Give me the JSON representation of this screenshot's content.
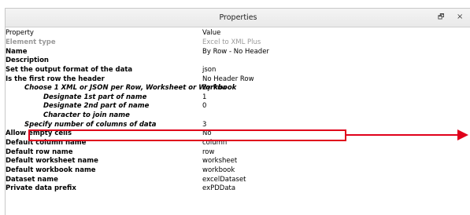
{
  "window": {
    "title": "Properties",
    "restore_glyph": "🗗",
    "close_glyph": "×"
  },
  "columns": {
    "property": "Property",
    "value": "Value"
  },
  "rows": [
    {
      "property": "Element type",
      "value": "Excel to XML Plus"
    },
    {
      "property": "Name",
      "value": "By Row - No Header"
    },
    {
      "property": "Description",
      "value": ""
    },
    {
      "property": "Set the output format of the data",
      "value": "json"
    },
    {
      "property": "Is the first row the header",
      "value": "No Header Row"
    },
    {
      "property": "Choose 1 XML or JSON per Row, Worksheet or Workbook",
      "value": "By Row"
    },
    {
      "property": "Designate 1st part of name",
      "value": "1"
    },
    {
      "property": "Designate 2nd part of name",
      "value": "0"
    },
    {
      "property": "Character to join name",
      "value": ""
    },
    {
      "property": "Specify number of columns of data",
      "value": "3"
    },
    {
      "property": "Allow empty cells",
      "value": "No"
    },
    {
      "property": "Default column name",
      "value": "column"
    },
    {
      "property": "Default row name",
      "value": "row"
    },
    {
      "property": "Default worksheet name",
      "value": "worksheet"
    },
    {
      "property": "Default workbook name",
      "value": "workbook"
    },
    {
      "property": "Dataset name",
      "value": "excelDataset"
    },
    {
      "property": "Private data prefix",
      "value": "exPDData"
    }
  ],
  "annotation": {
    "color": "#e0001b"
  }
}
